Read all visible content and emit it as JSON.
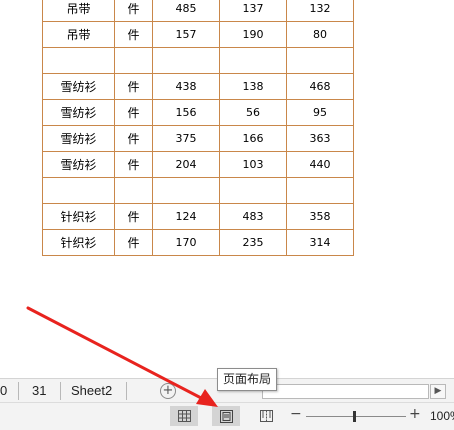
{
  "table": {
    "rows": [
      {
        "name": "吊带",
        "unit": "件",
        "v1": "485",
        "v2": "137",
        "v3": "132"
      },
      {
        "name": "吊带",
        "unit": "件",
        "v1": "157",
        "v2": "190",
        "v3": "80"
      },
      {
        "name": "",
        "unit": "",
        "v1": "",
        "v2": "",
        "v3": ""
      },
      {
        "name": "雪纺衫",
        "unit": "件",
        "v1": "438",
        "v2": "138",
        "v3": "468"
      },
      {
        "name": "雪纺衫",
        "unit": "件",
        "v1": "156",
        "v2": "56",
        "v3": "95"
      },
      {
        "name": "雪纺衫",
        "unit": "件",
        "v1": "375",
        "v2": "166",
        "v3": "363"
      },
      {
        "name": "雪纺衫",
        "unit": "件",
        "v1": "204",
        "v2": "103",
        "v3": "440"
      },
      {
        "name": "",
        "unit": "",
        "v1": "",
        "v2": "",
        "v3": ""
      },
      {
        "name": "针织衫",
        "unit": "件",
        "v1": "124",
        "v2": "483",
        "v3": "358"
      },
      {
        "name": "针织衫",
        "unit": "件",
        "v1": "170",
        "v2": "235",
        "v3": "314"
      }
    ],
    "border_color": "#c9874a"
  },
  "sheet_tabs": {
    "items": [
      "0",
      "31",
      "Sheet2"
    ],
    "add_label": "+"
  },
  "tooltip": {
    "text": "页面布局"
  },
  "status_bar": {
    "zoom_minus": "−",
    "zoom_plus": "+",
    "zoom_level": "100%",
    "active_view": "page-layout"
  },
  "annotation": {
    "arrow_color": "#e8231e"
  },
  "icons": [
    "add-sheet-icon",
    "normal-view-icon",
    "page-layout-view-icon",
    "page-break-preview-icon",
    "scroll-right-icon"
  ]
}
